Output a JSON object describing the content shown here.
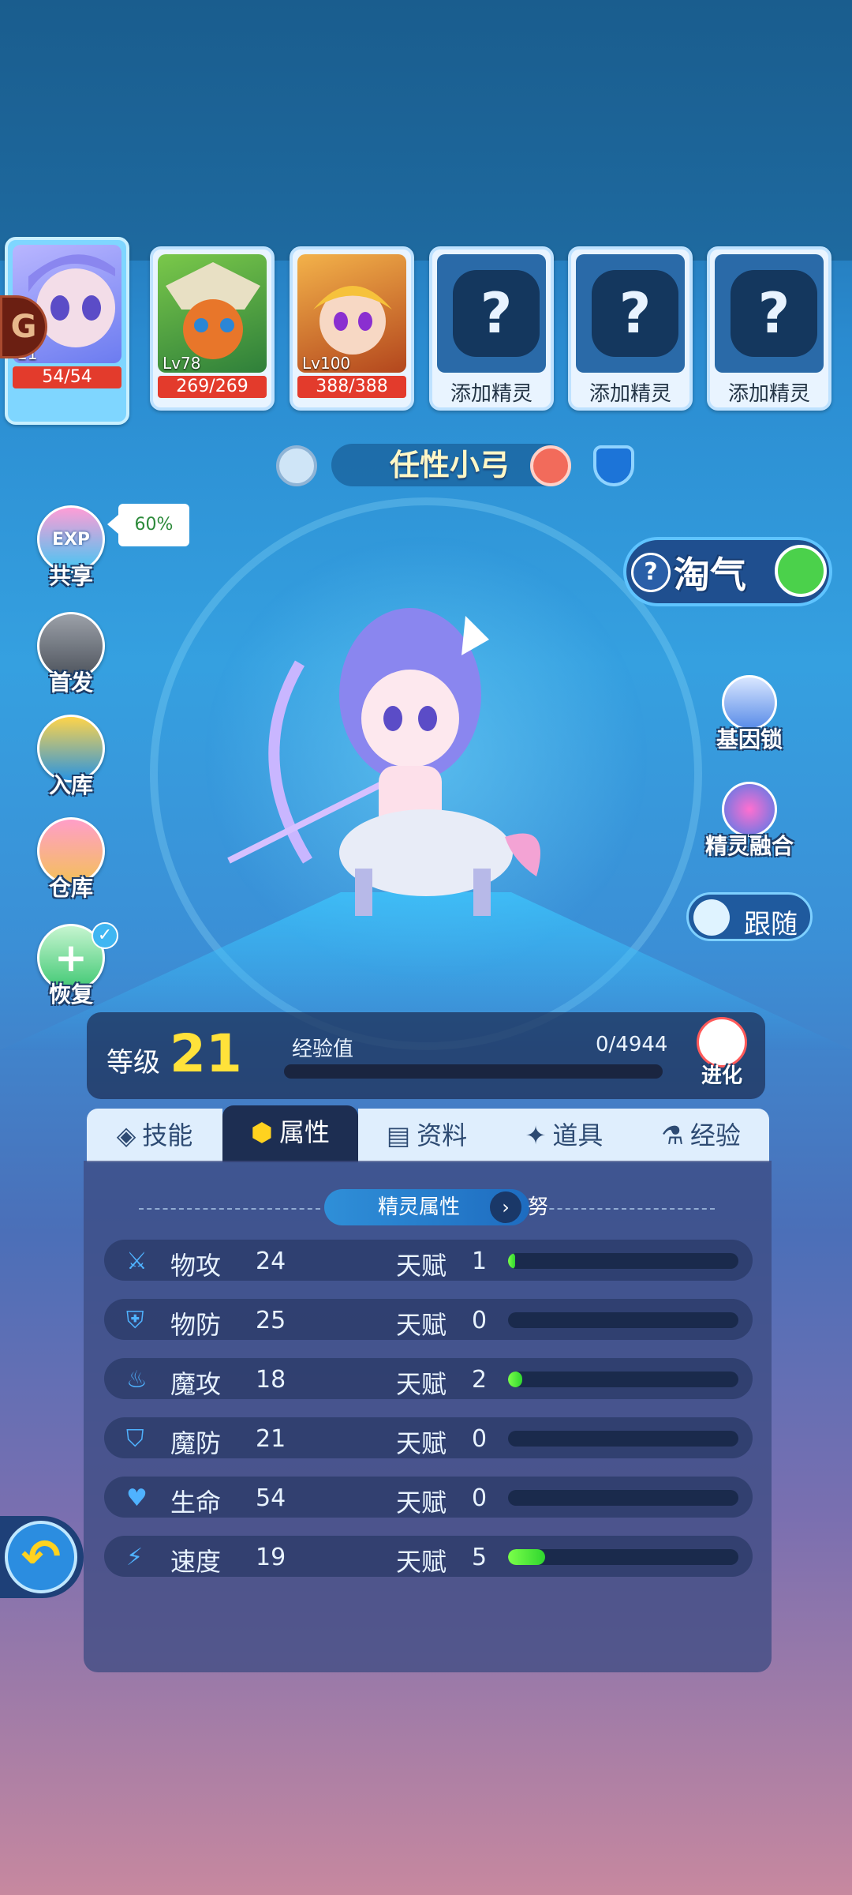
{
  "team": {
    "slots": [
      {
        "level": "21",
        "hp": "54/54",
        "active": true
      },
      {
        "level": "Lv78",
        "hp": "269/269"
      },
      {
        "level": "Lv100",
        "hp": "388/388"
      },
      {
        "add_label": "添加精灵"
      },
      {
        "add_label": "添加精灵"
      },
      {
        "add_label": "添加精灵"
      }
    ]
  },
  "pet": {
    "name": "任性小弓"
  },
  "left_menu": {
    "share": {
      "badge": "EXP",
      "label": "共享",
      "tip": "60%"
    },
    "first": {
      "label": "首发"
    },
    "store": {
      "label": "入库"
    },
    "warehouse": {
      "label": "仓库"
    },
    "recover": {
      "label": "恢复"
    }
  },
  "right_menu": {
    "taoqi": "淘气",
    "gene_lock": "基因锁",
    "fusion": "精灵融合",
    "follow": "跟随"
  },
  "level_panel": {
    "level_label": "等级",
    "level": "21",
    "exp_label": "经验值",
    "exp_value": "0/4944",
    "exp_progress": 0,
    "evolve": "进化"
  },
  "tabs": [
    {
      "label": "技能"
    },
    {
      "label": "属性",
      "active": true
    },
    {
      "label": "资料"
    },
    {
      "label": "道具"
    },
    {
      "label": "经验"
    }
  ],
  "attributes": {
    "section_title": "精灵属性",
    "nature": "努",
    "talent_label": "天赋",
    "rows": [
      {
        "name": "物攻",
        "value": "24",
        "talent": "1",
        "fill": 0.03,
        "icon": "sword-icon"
      },
      {
        "name": "物防",
        "value": "25",
        "talent": "0",
        "fill": 0,
        "icon": "shield-icon"
      },
      {
        "name": "魔攻",
        "value": "18",
        "talent": "2",
        "fill": 0.06,
        "icon": "flame-icon"
      },
      {
        "name": "魔防",
        "value": "21",
        "talent": "0",
        "fill": 0,
        "icon": "magic-shield-icon"
      },
      {
        "name": "生命",
        "value": "54",
        "talent": "0",
        "fill": 0,
        "icon": "heart-icon"
      },
      {
        "name": "速度",
        "value": "19",
        "talent": "5",
        "fill": 0.16,
        "icon": "boot-icon"
      }
    ]
  },
  "colors": {
    "accent": "#ffe23a",
    "hp": "#e33b2c",
    "talent_fill": "#2fd62f"
  }
}
